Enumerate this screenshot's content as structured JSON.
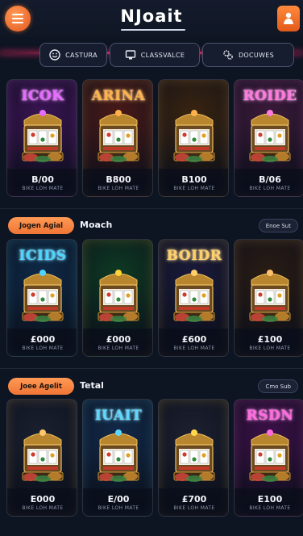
{
  "header": {
    "logo": "NJoait",
    "menu_icon": "hamburger-icon",
    "profile_icon": "profile-icon"
  },
  "tabs": [
    {
      "label": "CASTURA",
      "icon": "smiley-icon"
    },
    {
      "label": "CLASSVALCE",
      "icon": "monitor-icon"
    },
    {
      "label": "DOCUWES",
      "icon": "gears-icon"
    }
  ],
  "rows": [
    {
      "section": null,
      "cards": [
        {
          "title": "ICOK",
          "price": "B/00",
          "sub": "BIKE LOH MATE",
          "neon": "#e76bff",
          "bg": "#3a1454"
        },
        {
          "title": "ARINA",
          "price": "B800",
          "sub": "BIKE LOH MATE",
          "neon": "#ffb24a",
          "bg": "#4a1a18"
        },
        {
          "title": "",
          "price": "B100",
          "sub": "BIKE LOH MATE",
          "neon": "#ffb24a",
          "bg": "#3a2410"
        },
        {
          "title": "ROIDE",
          "price": "B/06",
          "sub": "BIKE LOH MATE",
          "neon": "#ff7ae0",
          "bg": "#3c1a3a"
        }
      ]
    },
    {
      "section": {
        "pill": "Jogen Agial",
        "title": "Moach",
        "more": "Enoe Sut"
      },
      "cards": [
        {
          "title": "ICIDS",
          "price": "£000",
          "sub": "BIKE LOH MATE",
          "neon": "#4fd3ff",
          "bg": "#0e2a48"
        },
        {
          "title": "",
          "price": "£000",
          "sub": "BIKE LOH MATE",
          "neon": "#ffd23a",
          "bg": "#0e3a24"
        },
        {
          "title": "BOIDR",
          "price": "£600",
          "sub": "BIKE LOH MATE",
          "neon": "#ffd06a",
          "bg": "#1a1a3a"
        },
        {
          "title": "",
          "price": "£100",
          "sub": "BIKE LOH MATE",
          "neon": "#ffc06a",
          "bg": "#2a1c14"
        }
      ]
    },
    {
      "section": {
        "pill": "Joee Agelit",
        "title": "Tetal",
        "more": "Cmo Sub"
      },
      "cards": [
        {
          "title": "",
          "price": "E000",
          "sub": "BIKE LOH MATE",
          "neon": "#ffc96a",
          "bg": "#1a2030"
        },
        {
          "title": "IUAIT",
          "price": "E/00",
          "sub": "BIKE LOH MATE",
          "neon": "#5fd8ff",
          "bg": "#122a4a"
        },
        {
          "title": "",
          "price": "£700",
          "sub": "BIKE LOH MATE",
          "neon": "#ffd74a",
          "bg": "#1c2030"
        },
        {
          "title": "RSDN",
          "price": "E100",
          "sub": "BIKE LOH MATE",
          "neon": "#ff6ae0",
          "bg": "#3c1048"
        }
      ]
    }
  ]
}
